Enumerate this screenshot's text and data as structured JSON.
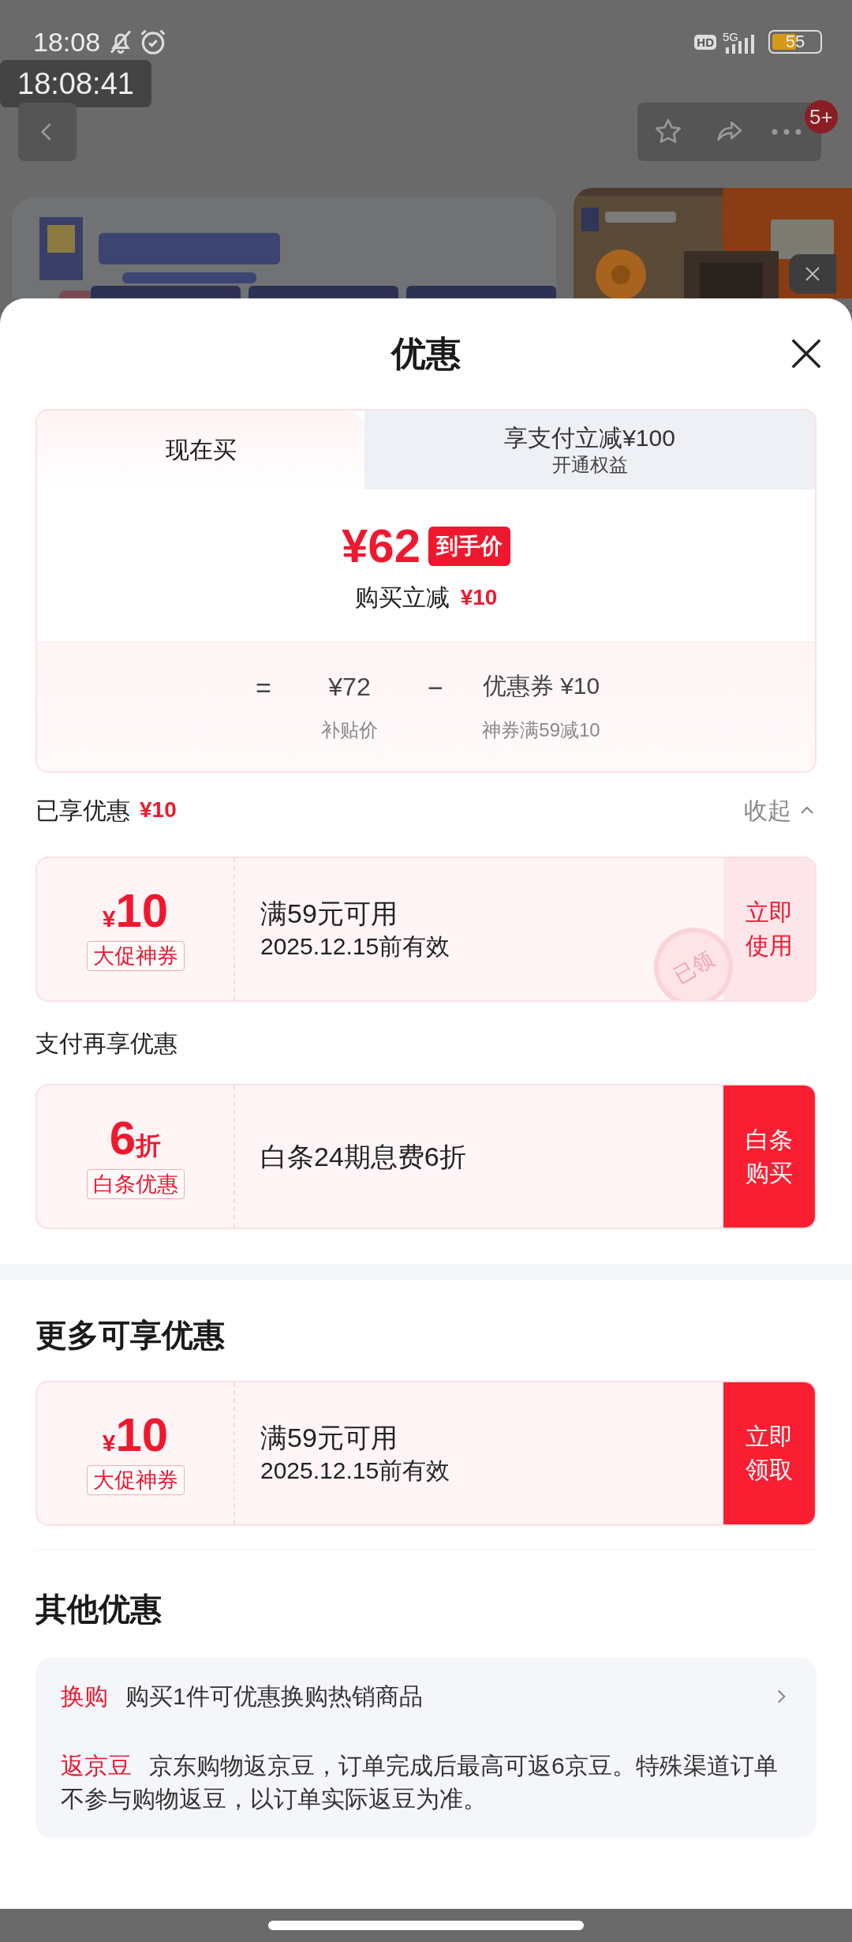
{
  "status_bar": {
    "time": "18:08",
    "hd": "HD",
    "network": "5G",
    "battery": "55"
  },
  "recording_time": "18:08:41",
  "top_bar": {
    "badge": "5+"
  },
  "sheet": {
    "title": "优惠"
  },
  "tabs": [
    {
      "label": "现在买",
      "selected": true
    },
    {
      "label": "享支付立减¥100",
      "sublabel": "开通权益",
      "selected": false
    }
  ],
  "price": {
    "amount": "¥62",
    "tag": "到手价",
    "saving_label": "购买立减",
    "saving_value": "¥10"
  },
  "formula": {
    "equals": "=",
    "base_price": "¥72",
    "base_label": "补贴价",
    "minus": "−",
    "coupon": "优惠券 ¥10",
    "coupon_label": "神券满59减10"
  },
  "enjoyed": {
    "label": "已享优惠",
    "amount": "¥10",
    "collapse": "收起",
    "expanded": true
  },
  "enjoyed_coupons": [
    {
      "prefix": "¥",
      "value": "10",
      "tag": "大促神券",
      "title": "满59元可用",
      "subtitle": "2025.12.15前有效",
      "action": "立即使用",
      "filled": false,
      "stamp": "已领"
    }
  ],
  "pay_heading": "支付再享优惠",
  "pay_coupons": [
    {
      "value": "6",
      "suffix": "折",
      "tag": "白条优惠",
      "title": "白条24期息费6折",
      "action": "白条购买",
      "filled": true
    }
  ],
  "more_heading": "更多可享优惠",
  "more_coupons": [
    {
      "prefix": "¥",
      "value": "10",
      "tag": "大促神券",
      "title": "满59元可用",
      "subtitle": "2025.12.15前有效",
      "action": "立即领取",
      "filled": true
    }
  ],
  "other_heading": "其他优惠",
  "other_items": [
    {
      "label": "换购",
      "text": "购买1件可优惠换购热销商品",
      "has_arrow": true
    },
    {
      "label": "返京豆",
      "text": "京东购物返京豆，订单完成后最高可返6京豆。特殊渠道订单不参与购物返豆，以订单实际返豆为准。",
      "has_arrow": false
    }
  ]
}
